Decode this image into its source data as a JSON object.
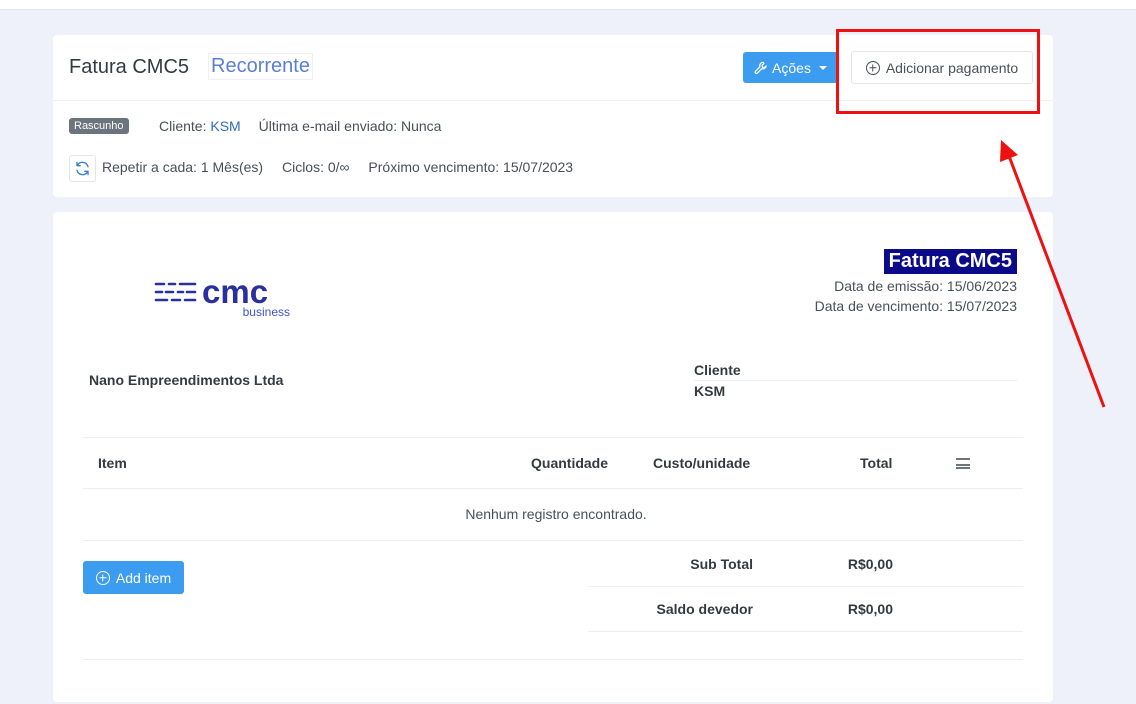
{
  "header": {
    "title": "Fatura CMC5",
    "recurring_label": "Recorrente",
    "actions_label": "Ações",
    "add_payment_label": "Adicionar pagamento"
  },
  "status": {
    "badge": "Rascunho",
    "client_prefix": "Cliente: ",
    "client_name": "KSM",
    "last_email": "Última e-mail enviado: Nunca"
  },
  "recurrence": {
    "repeat": "Repetir a cada: 1 Mês(es)",
    "cycles": "Ciclos: 0/∞",
    "next_due": "Próximo vencimento: 15/07/2023"
  },
  "invoice": {
    "logo_text": "cmc",
    "logo_sub": "business",
    "title": "Fatura CMC5",
    "issue_date": "Data de emissão: 15/06/2023",
    "due_date": "Data de vencimento: 15/07/2023",
    "company": "Nano Empreendimentos Ltda",
    "client_label": "Cliente",
    "client_value": "KSM"
  },
  "table": {
    "columns": [
      "Item",
      "Quantidade",
      "Custo/unidade",
      "Total"
    ],
    "empty_message": "Nenhum registro encontrado.",
    "add_item_label": "Add item"
  },
  "summary": {
    "subtotal_label": "Sub Total",
    "subtotal_value": "R$0,00",
    "balance_label": "Saldo devedor",
    "balance_value": "R$0,00"
  },
  "colors": {
    "primary_button": "#3b9cf0",
    "title_highlight": "#0b0b8a",
    "annotation": "#ee1111",
    "logo": "#2b2f9e"
  }
}
